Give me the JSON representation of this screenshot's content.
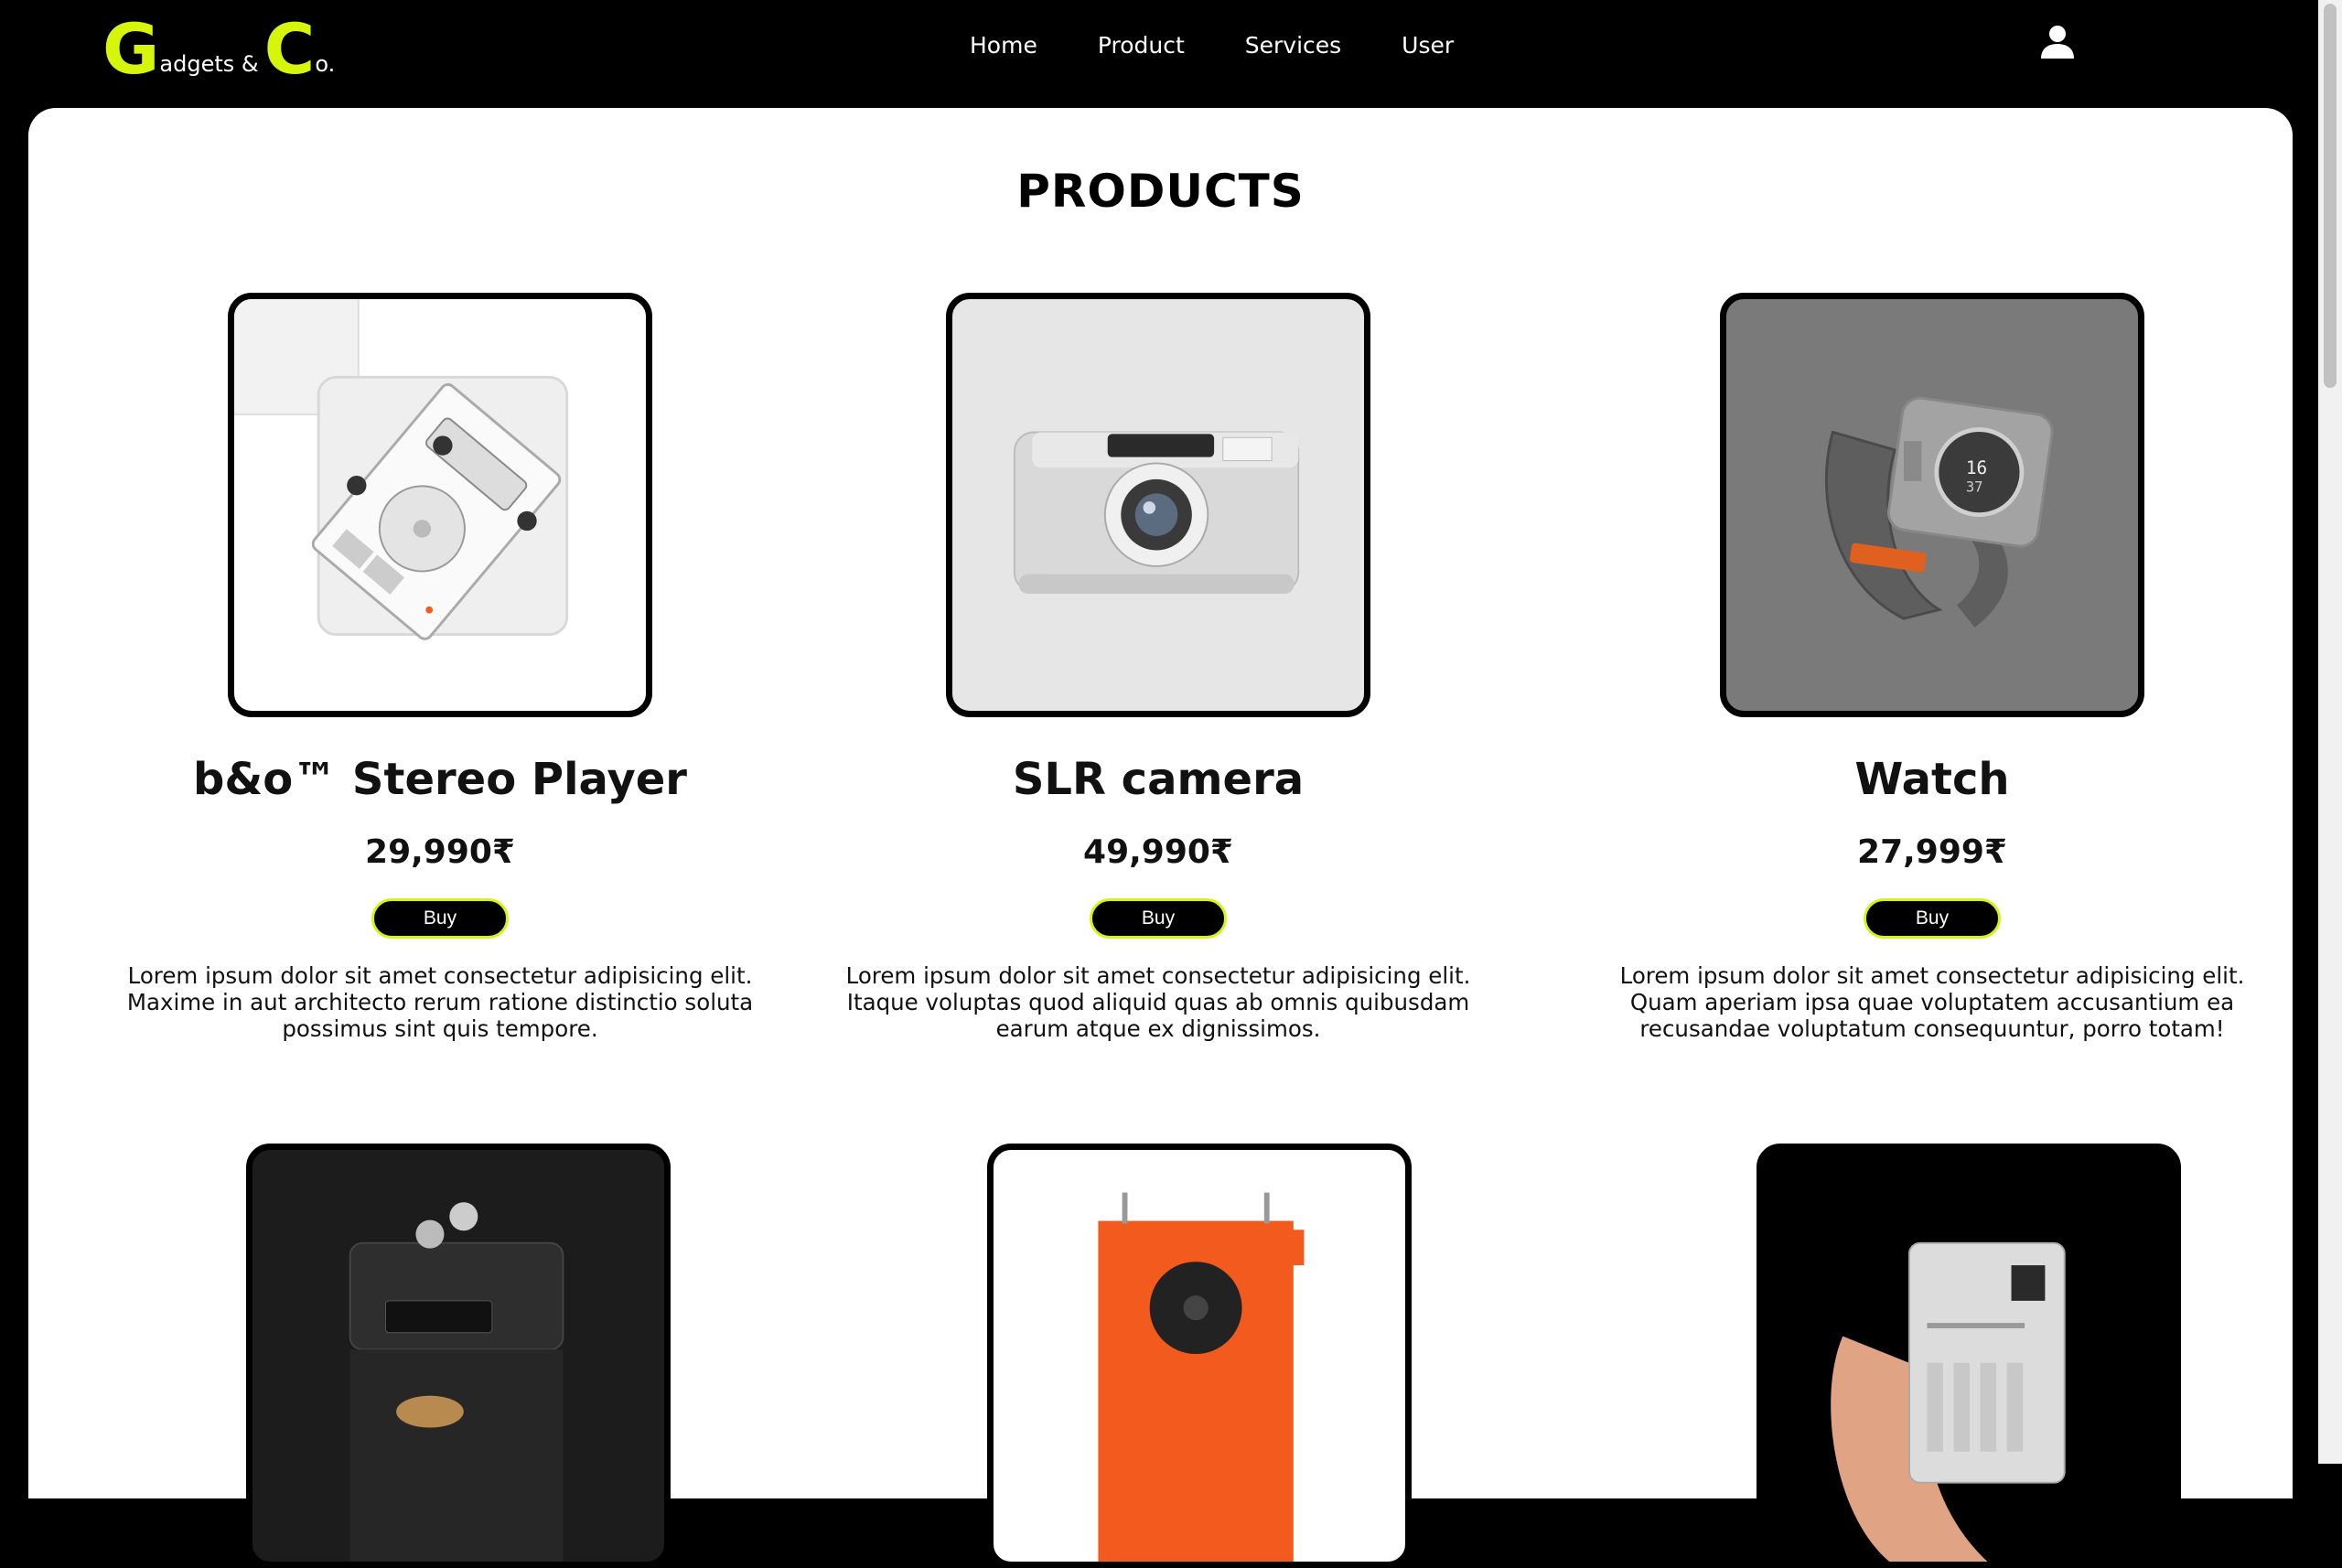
{
  "brand": {
    "letter1": "G",
    "word1": "adgets &",
    "letter2": "C",
    "word2": "o."
  },
  "nav": {
    "home": "Home",
    "product": "Product",
    "services": "Services",
    "user": "User"
  },
  "page_title": "PRODUCTS",
  "products": [
    {
      "name": "b&o™ Stereo Player",
      "price": "29,990₹",
      "buy_label": "Buy",
      "description": "Lorem ipsum dolor sit amet consectetur adipisicing elit. Maxime in aut architecto rerum ratione distinctio soluta possimus sint quis tempore."
    },
    {
      "name": "SLR camera",
      "price": "49,990₹",
      "buy_label": "Buy",
      "description": "Lorem ipsum dolor sit amet consectetur adipisicing elit. Itaque voluptas quod aliquid quas ab omnis quibusdam earum atque ex dignissimos."
    },
    {
      "name": "Watch",
      "price": "27,999₹",
      "buy_label": "Buy",
      "description": "Lorem ipsum dolor sit amet consectetur adipisicing elit. Quam aperiam ipsa quae voluptatem accusantium ea recusandae voluptatum consequuntur, porro totam!"
    }
  ],
  "colors": {
    "accent": "#d6f50a",
    "header_bg": "#000000",
    "panel_bg": "#ffffff",
    "product_orange": "#f25a1e"
  },
  "icons": {
    "user": "user-icon"
  }
}
